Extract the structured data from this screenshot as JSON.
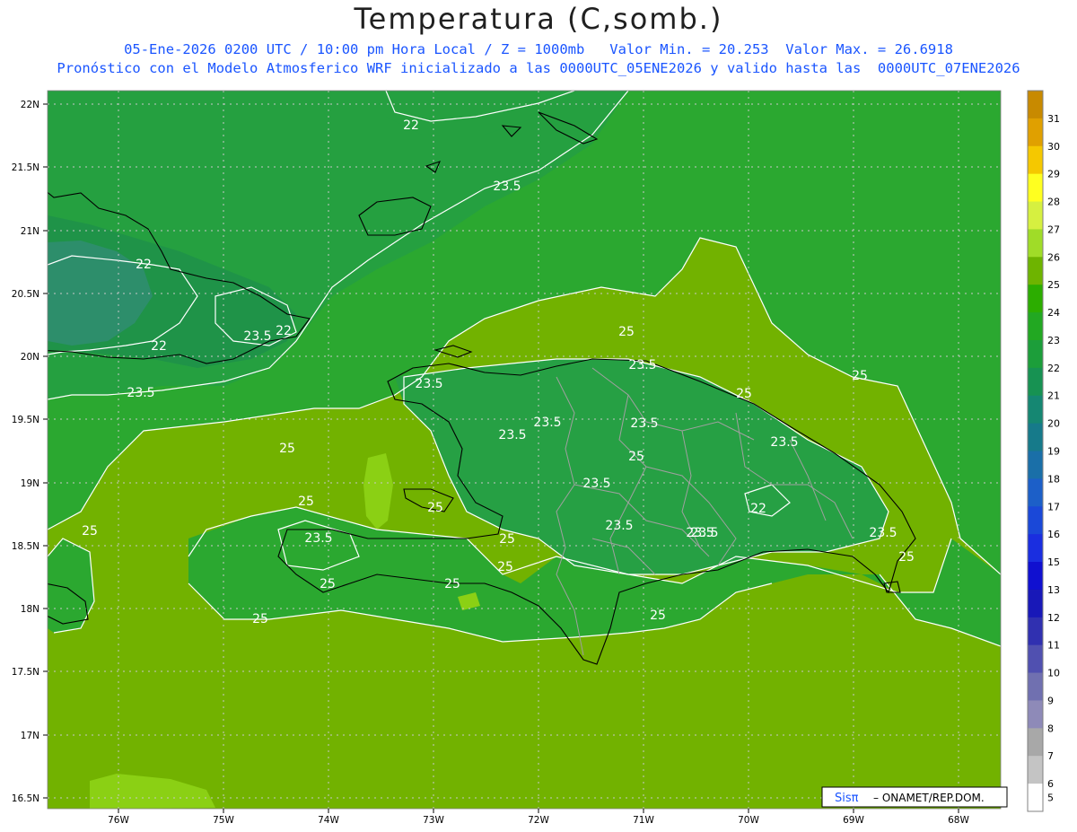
{
  "header": {
    "title": "Temperatura (C,somb.)",
    "subtitle_line1": "05-Ene-2026 0200 UTC / 10:00 pm Hora Local / Z = 1000mb   Valor Min. = 20.253  Valor Max. = 26.6918",
    "subtitle_line2": "Pronóstico con el Modelo Atmosferico WRF inicializado a las 0000UTC_05ENE2026 y valido hasta las  0000UTC_07ENE2026"
  },
  "map": {
    "lat_labels": [
      "22N",
      "21.5N",
      "21N",
      "20.5N",
      "20N",
      "19.5N",
      "19N",
      "18.5N",
      "18N",
      "17.5N",
      "17N",
      "16.5N"
    ],
    "lon_labels": [
      "76W",
      "75W",
      "74W",
      "73W",
      "72W",
      "71W",
      "70W",
      "69W",
      "68W"
    ],
    "contour_labels": [
      {
        "text": "22"
      },
      {
        "text": "23.5"
      },
      {
        "text": "22"
      },
      {
        "text": "22"
      },
      {
        "text": "22"
      },
      {
        "text": "23.5"
      },
      {
        "text": "23.5"
      },
      {
        "text": "25"
      },
      {
        "text": "25"
      },
      {
        "text": "25"
      },
      {
        "text": "25"
      },
      {
        "text": "25"
      },
      {
        "text": "23.5"
      },
      {
        "text": "23.5"
      },
      {
        "text": "23.5"
      },
      {
        "text": "23.5"
      },
      {
        "text": "23.5"
      },
      {
        "text": "23.5"
      },
      {
        "text": "23.5"
      },
      {
        "text": "25"
      },
      {
        "text": "25"
      },
      {
        "text": "23.5"
      },
      {
        "text": "25"
      },
      {
        "text": "25"
      },
      {
        "text": "25"
      },
      {
        "text": "25"
      },
      {
        "text": "23.5"
      },
      {
        "text": "23.5"
      },
      {
        "text": "22"
      },
      {
        "text": "23.5"
      },
      {
        "text": "25"
      },
      {
        "text": "25"
      },
      {
        "text": "23.5"
      },
      {
        "text": "25"
      },
      {
        "text": "25"
      }
    ],
    "watermark": {
      "brand": "Sisπ",
      "text": "– ONAMET/REP.DOM."
    }
  },
  "colorbar": {
    "labels": [
      "31",
      "30",
      "29",
      "28",
      "27",
      "26",
      "25",
      "24",
      "23",
      "22",
      "21",
      "20",
      "19",
      "18",
      "17",
      "16",
      "15",
      "13",
      "12",
      "11",
      "10",
      "9",
      "8",
      "7",
      "6",
      "5"
    ],
    "colors": [
      "#c88a00",
      "#e0a000",
      "#f5c800",
      "#ffff20",
      "#d6f040",
      "#a0dc28",
      "#6eb400",
      "#2cad00",
      "#22a822",
      "#1c9e3a",
      "#179252",
      "#158772",
      "#167a8a",
      "#1a6fa8",
      "#1c5fc8",
      "#1a48d8",
      "#1a2ee0",
      "#1010d0",
      "#1818b8",
      "#3030b0",
      "#5050b0",
      "#7070b0",
      "#8e8ab8",
      "#a8a8a8",
      "#c4c4c4",
      "#ffffff"
    ]
  },
  "colors": {
    "land_zone_gold": "#72b200",
    "sea_green": "#2ba830",
    "teal_patch": "#2d8e6b",
    "subtitle_blue": "#1a55ff"
  }
}
